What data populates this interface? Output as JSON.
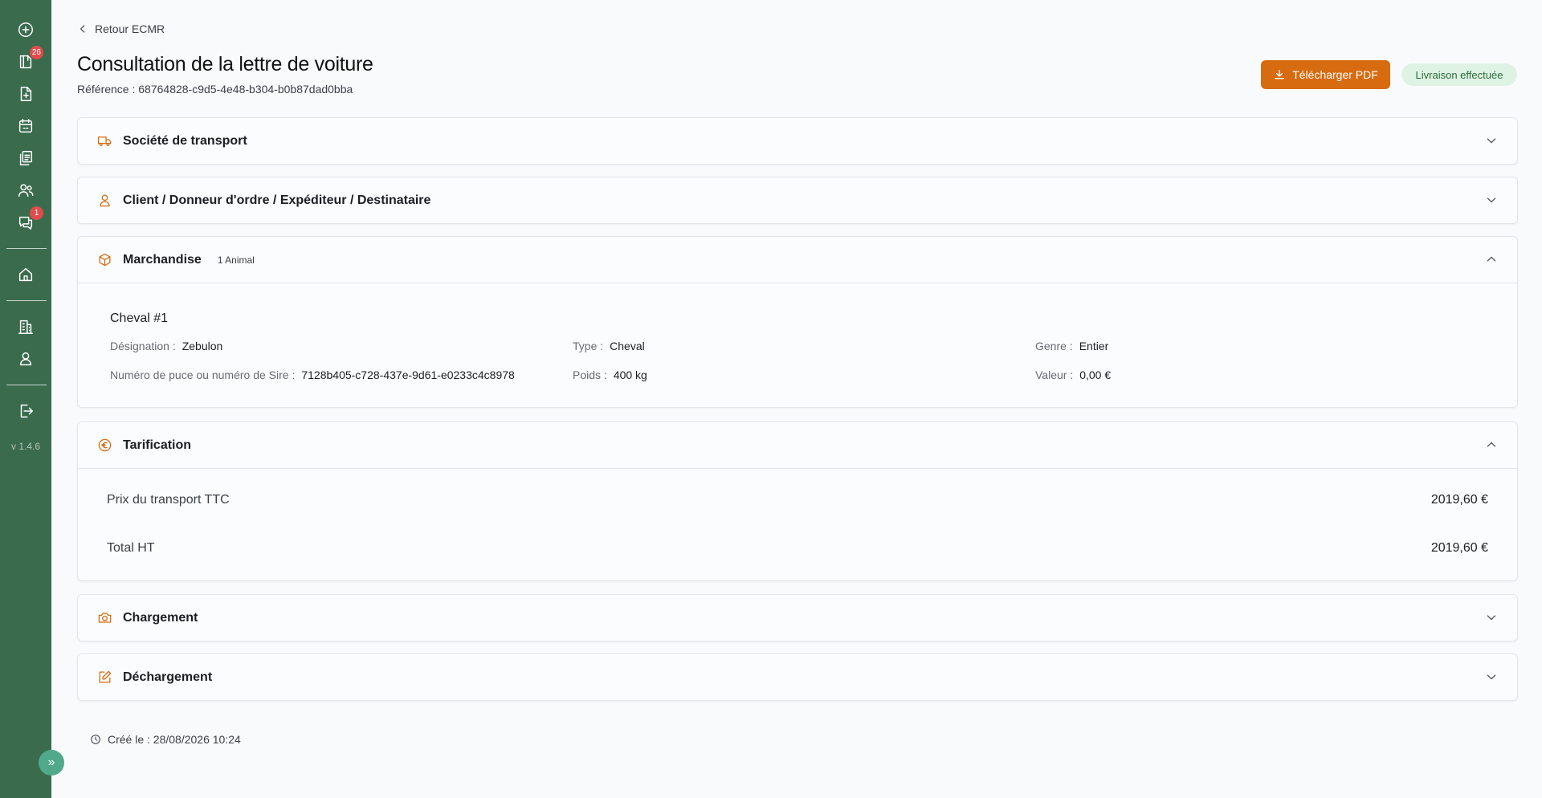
{
  "sidebar": {
    "badges": {
      "documents": "26",
      "messages": "1"
    },
    "version": "v 1.4.6"
  },
  "header": {
    "back_label": "Retour ECMR",
    "title": "Consultation de la lettre de voiture",
    "reference": "Référence : 68764828-c9d5-4e48-b304-b0b87dad0bba",
    "download_label": "Télécharger PDF",
    "status_label": "Livraison effectuée"
  },
  "sections": {
    "transport": {
      "label": "Société de transport",
      "icon": "truck-icon",
      "expanded": false
    },
    "client": {
      "label": "Client / Donneur d'ordre / Expéditeur / Destinataire",
      "icon": "user-icon",
      "expanded": false
    },
    "goods": {
      "label": "Marchandise",
      "sublabel": "1 Animal",
      "icon": "box-icon",
      "expanded": true,
      "item_title": "Cheval #1",
      "fields": {
        "designation": {
          "key": "Désignation :",
          "value": "Zebulon"
        },
        "type": {
          "key": "Type :",
          "value": "Cheval"
        },
        "genre": {
          "key": "Genre :",
          "value": "Entier"
        },
        "puce": {
          "key": "Numéro de puce ou numéro de Sire :",
          "value": "7128b405-c728-437e-9d61-e0233c4c8978"
        },
        "poids": {
          "key": "Poids :",
          "value": "400 kg"
        },
        "valeur": {
          "key": "Valeur :",
          "value": "0,00 €"
        }
      }
    },
    "pricing": {
      "label": "Tarification",
      "icon": "euro-icon",
      "expanded": true,
      "rows": [
        {
          "key": "Prix du transport TTC",
          "value": "2019,60 €"
        },
        {
          "key": "Total HT",
          "value": "2019,60 €"
        }
      ]
    },
    "loading": {
      "label": "Chargement",
      "icon": "camera-icon",
      "expanded": false
    },
    "unloading": {
      "label": "Déchargement",
      "icon": "edit-icon",
      "expanded": false
    }
  },
  "footer": {
    "created": "Créé le : 28/08/2026 10:24"
  },
  "colors": {
    "sidebar": "#3a6b4d",
    "accent": "#d66b10",
    "status_bg": "#dff3e4",
    "status_text": "#2a6b3c",
    "badge": "#e24b4b"
  }
}
